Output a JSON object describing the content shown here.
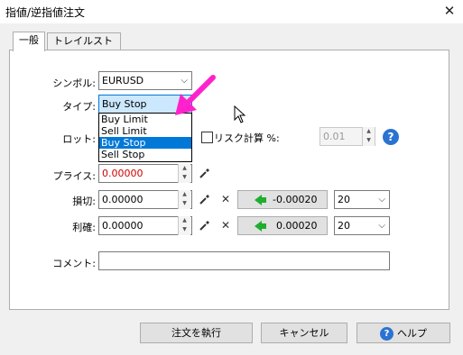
{
  "window": {
    "title": "指値/逆指値注文",
    "close_glyph": "✕"
  },
  "tabs": [
    {
      "label": "一般",
      "active": true
    },
    {
      "label": "トレイルストップ",
      "active": false
    }
  ],
  "form": {
    "symbol_label": "シンボル:",
    "symbol_value": "EURUSD",
    "type_label": "タイプ:",
    "type_value": "Buy Stop",
    "type_options": [
      "Buy Limit",
      "Sell Limit",
      "Buy Stop",
      "Sell Stop"
    ],
    "type_selected_index": 2,
    "lot_label": "ロット:",
    "risk_label": "リスク計算 %:",
    "risk_value": "0.01",
    "price_label": "プライス:",
    "price_value": "0.00000",
    "sl_label": "損切:",
    "sl_value": "0.00000",
    "sl_level_button": "-0.00020",
    "sl_points": "20",
    "tp_label": "利確:",
    "tp_value": "0.00000",
    "tp_level_button": "0.00020",
    "tp_points": "20",
    "comment_label": "コメント:",
    "comment_value": ""
  },
  "buttons": {
    "execute": "注文を執行",
    "cancel": "キャンセル",
    "help": "ヘルプ",
    "help_icon_glyph": "?"
  },
  "colors": {
    "accent": "#0078d7",
    "price_text": "#d00000",
    "arrow_green": "#1fae2f",
    "annotation_arrow": "#ff22cc"
  }
}
